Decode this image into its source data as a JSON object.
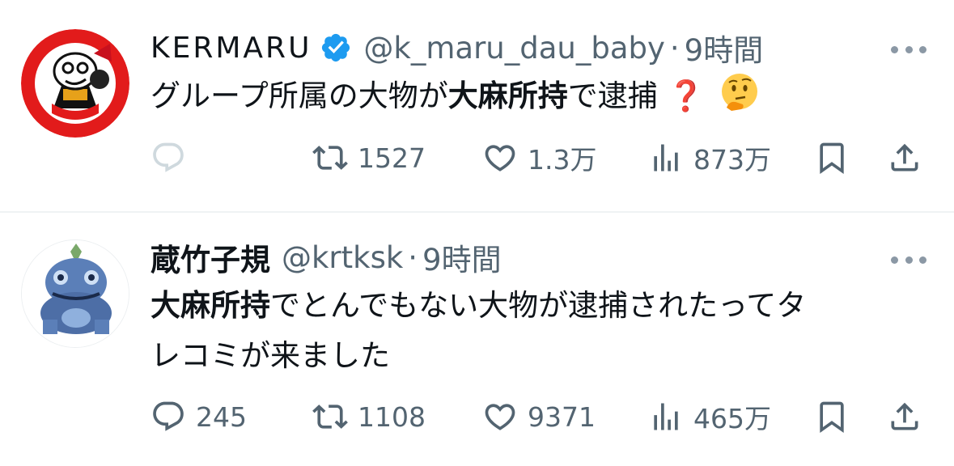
{
  "tweets": [
    {
      "author": {
        "display_name": "KERMARU",
        "handle": "@k_maru_dau_baby",
        "verified": true
      },
      "separator": "·",
      "time": "9時間",
      "text": {
        "part1": "グループ所属の大物が",
        "bold": "大麻所持",
        "part2": "で逮捕",
        "emoji": "❓"
      },
      "actions": {
        "replies": "",
        "retweets": "1527",
        "likes": "1.3万",
        "views": "873万"
      }
    },
    {
      "author": {
        "display_name": "蔵竹子規",
        "handle": "@krtksk",
        "verified": false
      },
      "separator": "·",
      "time": "9時間",
      "text": {
        "bold": "大麻所持",
        "part1": "でとんでもない大物が逮捕されたってタ",
        "part2": "レコミが来ました"
      },
      "actions": {
        "replies": "245",
        "retweets": "1108",
        "likes": "9371",
        "views": "465万"
      }
    }
  ],
  "colors": {
    "text_primary": "#0f1419",
    "text_secondary": "#536471",
    "verified_blue": "#1d9bf0",
    "reply_disabled": "#cfd9de"
  },
  "icons": [
    "reply-icon",
    "retweet-icon",
    "like-icon",
    "views-icon",
    "bookmark-icon",
    "share-icon",
    "verified-badge-icon",
    "more-icon",
    "thinking-face-emoji"
  ]
}
